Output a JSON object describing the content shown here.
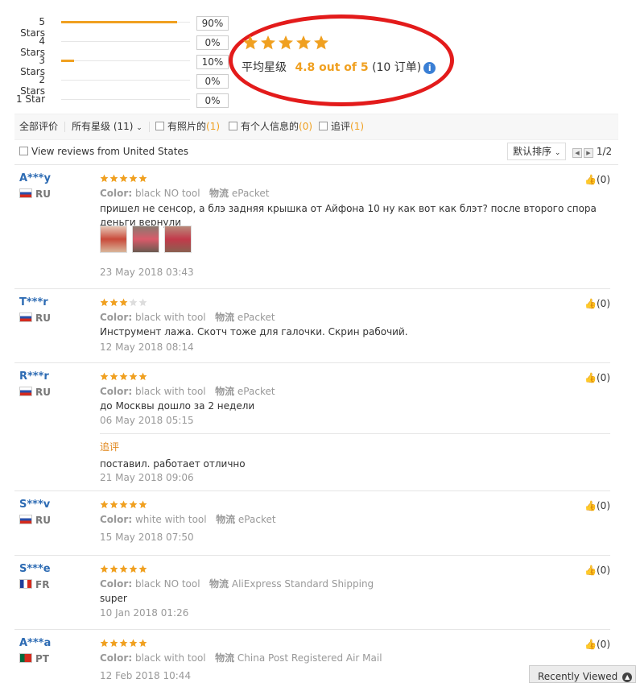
{
  "distribution": [
    {
      "label": "5 Stars",
      "percent_text": "90%",
      "fill": 0.9
    },
    {
      "label": "4 Stars",
      "percent_text": "0%",
      "fill": 0
    },
    {
      "label": "3 Stars",
      "percent_text": "10%",
      "fill": 0.1
    },
    {
      "label": "2 Stars",
      "percent_text": "0%",
      "fill": 0
    },
    {
      "label": "1 Star",
      "percent_text": "0%",
      "fill": 0
    }
  ],
  "summary": {
    "stars_filled": 5,
    "avg_label": "平均星级",
    "avg_value": "4.8 out of 5",
    "order_count": "(10 订单)",
    "info_icon": "i"
  },
  "filters": {
    "all_reviews": "全部评价",
    "all_stars": "所有星级 (11)",
    "with_photos_label": "有照片的",
    "with_photos_count": "(1)",
    "with_personal_label": "有个人信息的",
    "with_personal_count": "(0)",
    "followup_label": "追评",
    "followup_count": "(1)",
    "view_us": "View reviews from United States",
    "sort_label": "默认排序",
    "page_indicator": "1/2"
  },
  "colors": {
    "accent": "#f0a020",
    "name_blue": "#2d6bb3",
    "oval_red": "#e31b1b"
  },
  "reviews": [
    {
      "name": "A***y",
      "country": "RU",
      "stars": 5,
      "meta_color_label": "Color:",
      "meta_color": "black NO tool",
      "meta_ship_label": "物流",
      "meta_ship": "ePacket",
      "text": "пришел не сенсор, а блэ задняя крышка от Айфона 10 ну как вот как блэт? после второго спора деньги вернули",
      "date": "23 May 2018 03:43",
      "likes": "(0)"
    },
    {
      "name": "T***r",
      "country": "RU",
      "stars": 3,
      "meta_color_label": "Color:",
      "meta_color": "black with tool",
      "meta_ship_label": "物流",
      "meta_ship": "ePacket",
      "text": "Инструмент лажа. Скотч тоже для галочки. Скрин рабочий.",
      "date": "12 May 2018 08:14",
      "likes": "(0)"
    },
    {
      "name": "R***r",
      "country": "RU",
      "stars": 5,
      "meta_color_label": "Color:",
      "meta_color": "black with tool",
      "meta_ship_label": "物流",
      "meta_ship": "ePacket",
      "text": "до Москвы дошло за 2 недели",
      "date": "06 May 2018 05:15",
      "likes": "(0)",
      "followup_title": "追评",
      "followup_text": "поставил. работает отлично",
      "followup_date": "21 May 2018 09:06"
    },
    {
      "name": "S***v",
      "country": "RU",
      "stars": 5,
      "meta_color_label": "Color:",
      "meta_color": "white with tool",
      "meta_ship_label": "物流",
      "meta_ship": "ePacket",
      "text": "",
      "date": "15 May 2018 07:50",
      "likes": "(0)"
    },
    {
      "name": "S***e",
      "country": "FR",
      "stars": 5,
      "meta_color_label": "Color:",
      "meta_color": "black NO tool",
      "meta_ship_label": "物流",
      "meta_ship": "AliExpress Standard Shipping",
      "text": "super",
      "date": "10 Jan 2018 01:26",
      "likes": "(0)"
    },
    {
      "name": "A***a",
      "country": "PT",
      "stars": 5,
      "meta_color_label": "Color:",
      "meta_color": "black with tool",
      "meta_ship_label": "物流",
      "meta_ship": "China Post Registered Air Mail",
      "text": "",
      "date": "12 Feb 2018 10:44",
      "likes": "(0)"
    }
  ],
  "recently_viewed": "Recently Viewed"
}
